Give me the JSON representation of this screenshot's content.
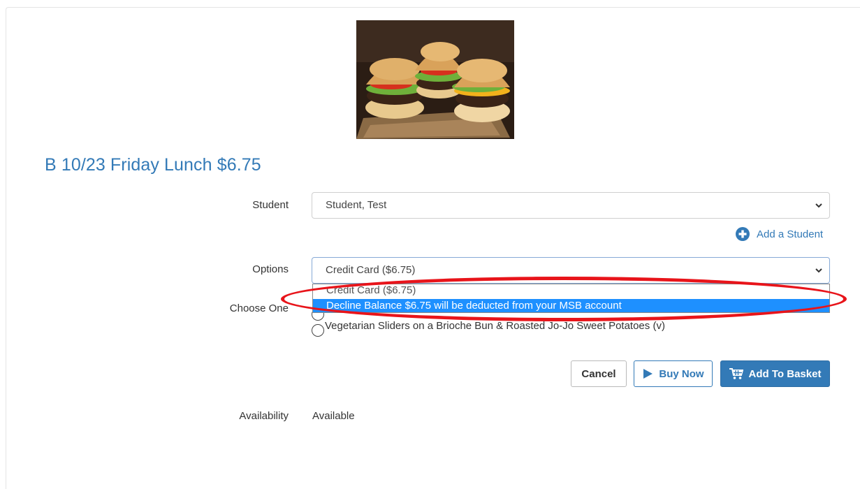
{
  "item": {
    "title": "B 10/23 Friday Lunch $6.75"
  },
  "form": {
    "student_label": "Student",
    "student_value": "Student, Test",
    "add_student_label": "Add a Student",
    "options_label": "Options",
    "options_value": "Credit Card ($6.75)",
    "options_list": [
      "Credit Card ($6.75)",
      "Decline Balance $6.75 will be deducted from your MSB account"
    ],
    "choose_one_label": "Choose One",
    "choices": [
      "Vegetarian Sliders on a Brioche Bun & Roasted Jo-Jo Sweet Potatoes (v)"
    ],
    "availability_label": "Availability",
    "availability_value": "Available"
  },
  "actions": {
    "cancel": "Cancel",
    "buy_now": "Buy Now",
    "add_to_basket": "Add To Basket"
  },
  "icons": {
    "add": "plus-circle-icon",
    "play": "play-icon",
    "cart": "cart-icon",
    "chevron": "chevron-down-icon"
  },
  "colors": {
    "primary": "#337ab7",
    "highlight": "#1e90ff",
    "annotation": "#e8141a"
  }
}
